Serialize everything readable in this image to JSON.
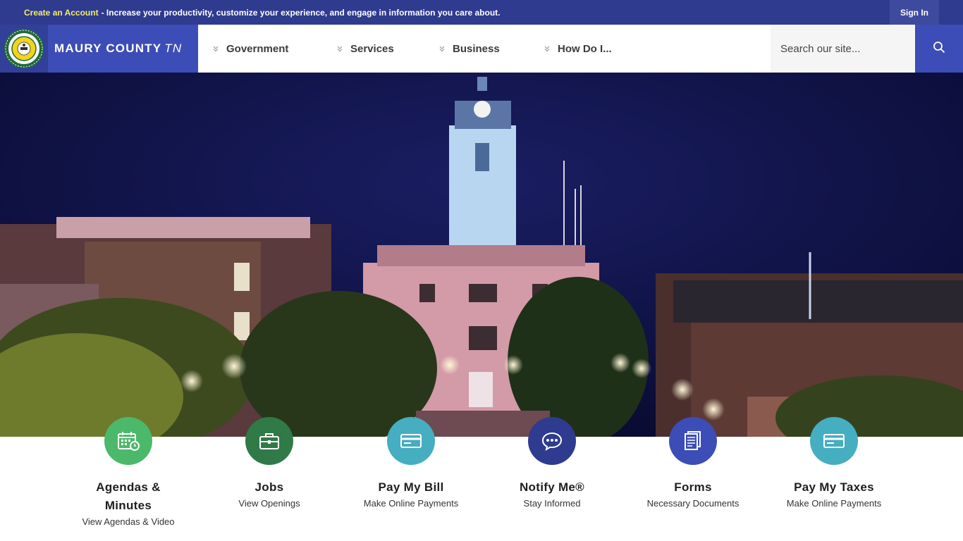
{
  "topbar": {
    "create_link": "Create an Account",
    "promo_text": "- Increase your productivity, customize your experience, and engage in information you care about.",
    "sign_in": "Sign In"
  },
  "header": {
    "brand_name": "MAURY COUNTY",
    "brand_suffix": "TN",
    "nav": [
      {
        "label": "Government"
      },
      {
        "label": "Services"
      },
      {
        "label": "Business"
      },
      {
        "label": "How Do I..."
      }
    ],
    "search": {
      "placeholder": "Search our site..."
    }
  },
  "quick_links": [
    {
      "title": "Agendas & Minutes",
      "subtitle": "View Agendas & Video",
      "icon": "calendar-clock-icon",
      "color": "#4cb86a"
    },
    {
      "title": "Jobs",
      "subtitle": "View Openings",
      "icon": "briefcase-icon",
      "color": "#2f7a47"
    },
    {
      "title": "Pay My Bill",
      "subtitle": "Make Online Payments",
      "icon": "credit-card-icon",
      "color": "#45aec0"
    },
    {
      "title": "Notify Me®",
      "subtitle": "Stay Informed",
      "icon": "chat-bubble-icon",
      "color": "#2e3b8f"
    },
    {
      "title": "Forms",
      "subtitle": "Necessary Documents",
      "icon": "documents-icon",
      "color": "#3d4db7"
    },
    {
      "title": "Pay My Taxes",
      "subtitle": "Make Online Payments",
      "icon": "credit-card-icon",
      "color": "#45aec0"
    }
  ],
  "colors": {
    "topbar": "#2e3b8f",
    "brand": "#3d4db7",
    "accent_link": "#f6ec6a"
  }
}
